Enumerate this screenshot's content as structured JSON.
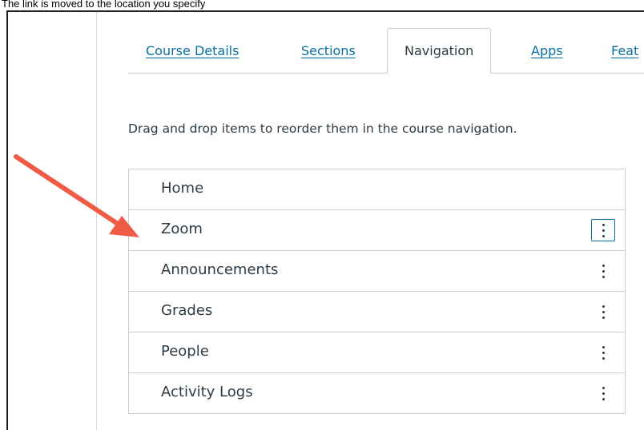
{
  "caption": "The link is moved to the location you specify",
  "tabs": [
    {
      "label": "Course Details",
      "active": false
    },
    {
      "label": "Sections",
      "active": false
    },
    {
      "label": "Navigation",
      "active": true
    },
    {
      "label": "Apps",
      "active": false
    },
    {
      "label": "Feat",
      "active": false
    }
  ],
  "instructions": "Drag and drop items to reorder them in the course navigation.",
  "nav_items": [
    {
      "label": "Home",
      "has_menu": false
    },
    {
      "label": "Zoom",
      "has_menu": true,
      "focused": true
    },
    {
      "label": "Announcements",
      "has_menu": true
    },
    {
      "label": "Grades",
      "has_menu": true
    },
    {
      "label": "People",
      "has_menu": true
    },
    {
      "label": "Activity Logs",
      "has_menu": true
    }
  ],
  "colors": {
    "link": "#0770a3",
    "text": "#2d3b45",
    "border": "#c7cdd1",
    "arrow": "#ef5b45"
  },
  "icons": {
    "item_menu": "kebab-vertical-icon",
    "pointer": "red-arrow-icon"
  }
}
